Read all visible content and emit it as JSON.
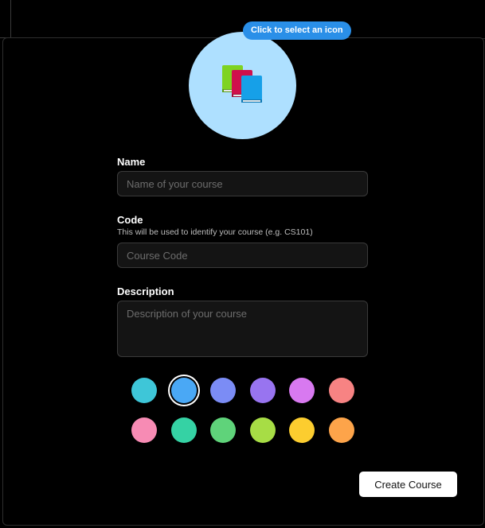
{
  "icon_picker": {
    "badge_label": "Click to select an icon",
    "icon": "books-icon"
  },
  "form": {
    "name": {
      "label": "Name",
      "placeholder": "Name of your course",
      "value": ""
    },
    "code": {
      "label": "Code",
      "hint": "This will be used to identify your course (e.g. CS101)",
      "placeholder": "Course Code",
      "value": ""
    },
    "description": {
      "label": "Description",
      "placeholder": "Description of your course",
      "value": ""
    }
  },
  "colors": {
    "selected_index": 1,
    "swatches": [
      "#3ec6d8",
      "#4aa8f5",
      "#7b8cf5",
      "#9874f0",
      "#d879f0",
      "#f78383",
      "#f78bb4",
      "#35d2a4",
      "#5fd37a",
      "#a7dd45",
      "#fccd2f",
      "#fda44a"
    ]
  },
  "actions": {
    "create_label": "Create Course"
  }
}
